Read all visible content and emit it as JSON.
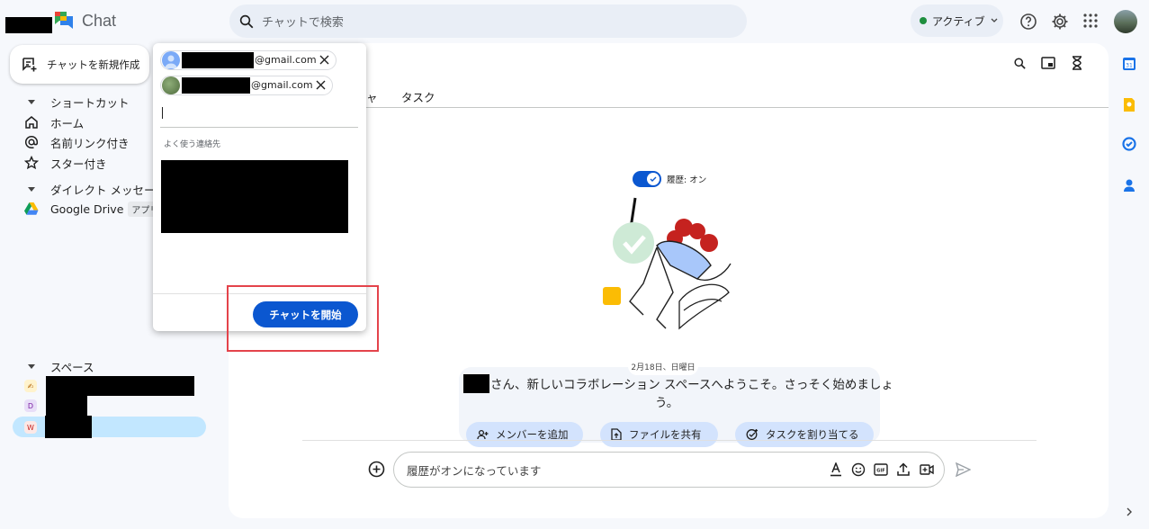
{
  "app": {
    "title": "Chat"
  },
  "search": {
    "placeholder": "チャットで検索"
  },
  "status": {
    "label": "アクティブ",
    "color": "#1e8e3e"
  },
  "sidebar": {
    "new_chat_label": "チャットを新規作成",
    "shortcuts_title": "ショートカット",
    "items": [
      {
        "label": "ホーム",
        "icon": "home-icon"
      },
      {
        "label": "名前リンク付き",
        "icon": "at-icon"
      },
      {
        "label": "スター付き",
        "icon": "star-icon"
      }
    ],
    "dm_title": "ダイレクト メッセージ",
    "dm_items": [
      {
        "label": "Google Drive",
        "badge": "アプリ",
        "icon": "google-drive-icon"
      }
    ],
    "spaces_title": "スペース",
    "spaces": [
      {
        "icon_text": "✍",
        "color": "#fff3cd"
      },
      {
        "icon_text": "D",
        "color": "#e8def8"
      },
      {
        "icon_text": "W",
        "color": "#fce8e6"
      }
    ]
  },
  "popover": {
    "recipients": [
      {
        "email_suffix": "@gmail.com"
      },
      {
        "email_suffix": "@gmail.com"
      }
    ],
    "frequent_label": "よく使う連絡先",
    "start_chat_label": "チャットを開始"
  },
  "main": {
    "tabs": [
      "チャット",
      "タスク"
    ],
    "tab_visible_fragment": "ャ",
    "history_label": "履歴: オン",
    "date_label": "2月18日、日曜日",
    "welcome_line1": "さん、新しいコラボレーション スペースへようこそ。さっそく始めましょ",
    "welcome_line2": "う。",
    "actions": [
      {
        "label": "メンバーを追加",
        "icon": "add-people-icon"
      },
      {
        "label": "ファイルを共有",
        "icon": "file-share-icon"
      },
      {
        "label": "タスクを割り当てる",
        "icon": "add-task-icon"
      }
    ],
    "composer_placeholder": "履歴がオンになっています"
  },
  "colors": {
    "accent": "#0b57d0",
    "highlight_border": "#e4434b"
  }
}
